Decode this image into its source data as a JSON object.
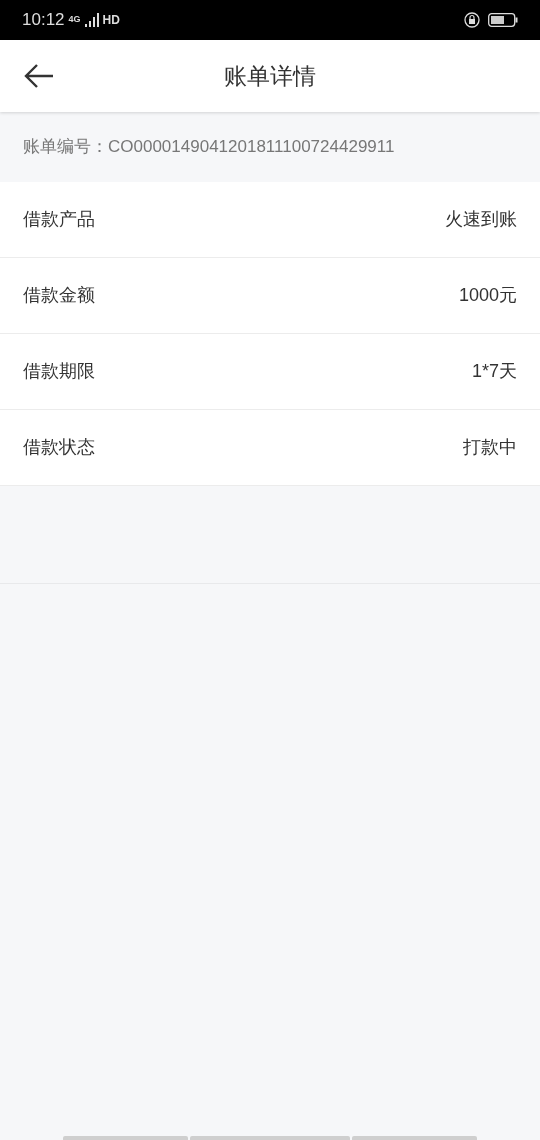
{
  "status_bar": {
    "time": "10:12",
    "network": "4G",
    "hd": "HD"
  },
  "header": {
    "title": "账单详情"
  },
  "bill_number": {
    "label": "账单编号：",
    "value": "CO0000149041201811100724429911"
  },
  "details": [
    {
      "label": "借款产品",
      "value": "火速到账"
    },
    {
      "label": "借款金额",
      "value": "1000元"
    },
    {
      "label": "借款期限",
      "value": "1*7天"
    },
    {
      "label": "借款状态",
      "value": "打款中"
    }
  ]
}
